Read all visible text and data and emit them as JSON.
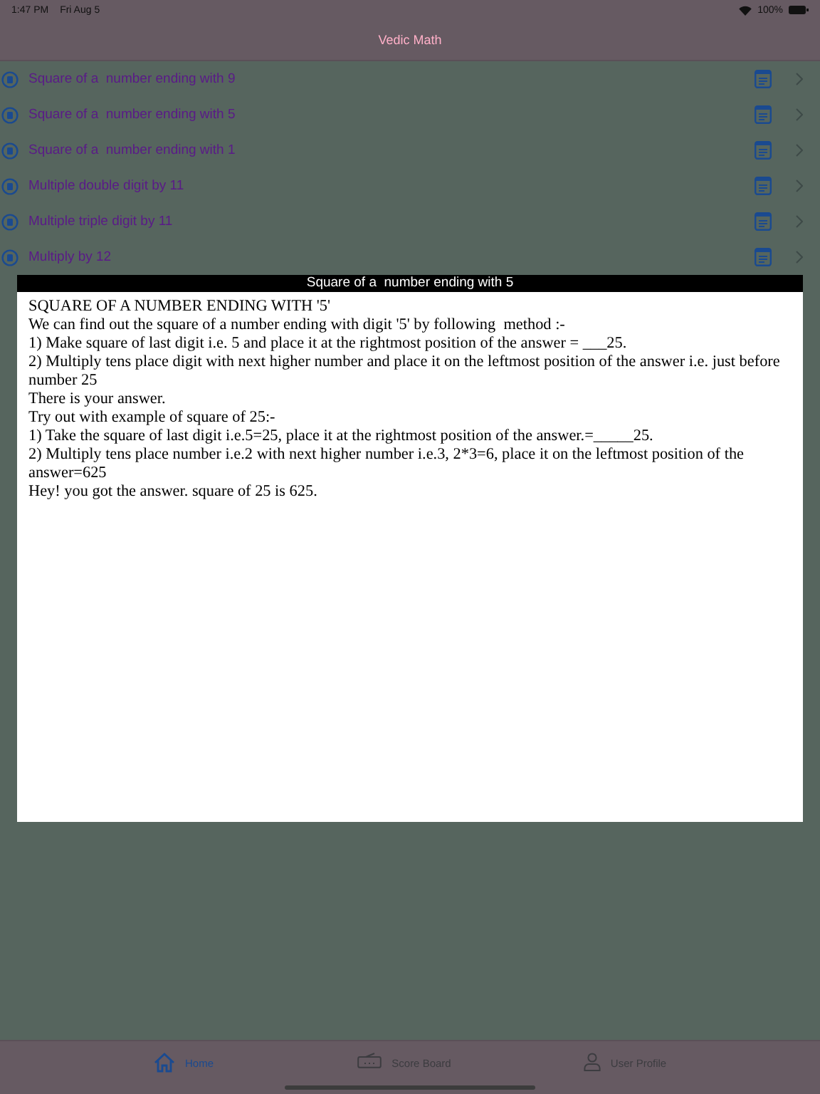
{
  "status_bar": {
    "time": "1:47 PM",
    "date": "Fri Aug 5",
    "battery": "100%"
  },
  "nav_bar": {
    "title": "Vedic Math"
  },
  "list": [
    {
      "label": "Square of a  number ending with 9"
    },
    {
      "label": "Square of a  number ending with 5"
    },
    {
      "label": "Square of a  number ending with 1"
    },
    {
      "label": "Multiple double digit by 11"
    },
    {
      "label": "Multiple triple digit by 11"
    },
    {
      "label": "Multiply by 12"
    }
  ],
  "popup": {
    "title": "Square of a  number ending with 5",
    "lines": [
      "SQUARE OF A NUMBER ENDING WITH '5'",
      "We can find out the square of a number ending with digit '5' by following  method :-",
      "1) Make square of last digit i.e. 5 and place it at the rightmost position of the answer = ___25.",
      "2) Multiply tens place digit with next higher number and place it on the leftmost position of the answer i.e. just before number 25",
      "There is your answer.",
      "Try out with example of square of 25:-",
      "1) Take the square of last digit i.e.5=25, place it at the rightmost position of the answer.=_____25.",
      "2) Multiply tens place number i.e.2 with next higher number i.e.3, 2*3=6, place it on the leftmost position of the answer=625",
      "Hey! you got the answer. square of 25 is 625."
    ]
  },
  "tab_bar": [
    {
      "label": "Home",
      "kind": "home",
      "selected": true
    },
    {
      "label": "Score Board",
      "kind": "score",
      "selected": false
    },
    {
      "label": "User Profile",
      "kind": "user",
      "selected": false
    }
  ]
}
